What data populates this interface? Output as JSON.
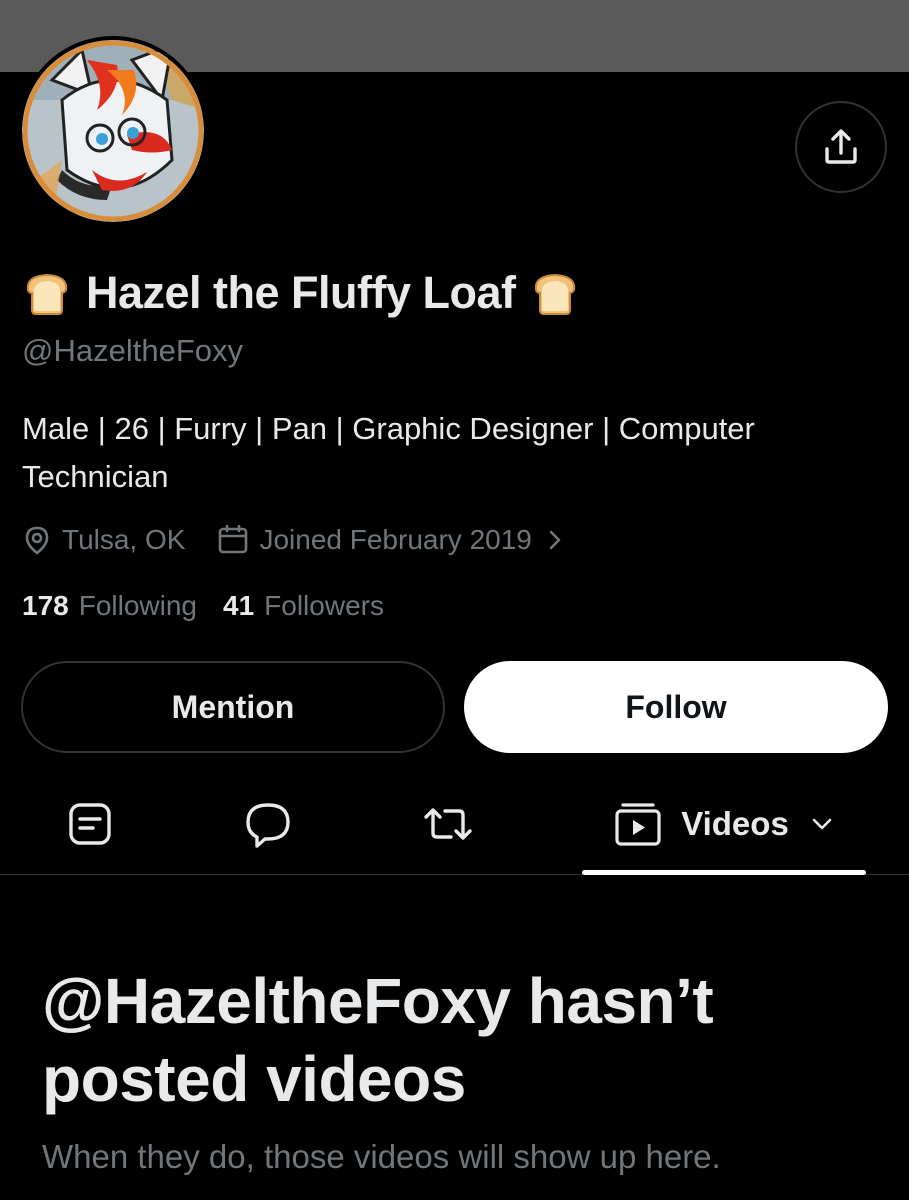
{
  "profile": {
    "display_name": "Hazel the Fluffy Loaf",
    "name_emoji_left": "bread-emoji",
    "name_emoji_right": "bread-emoji",
    "handle": "@HazeltheFoxy",
    "bio": "Male | 26 | Furry | Pan | Graphic Designer | Computer Technician",
    "location": "Tulsa, OK",
    "joined": "Joined February 2019",
    "following_count": "178",
    "following_label": "Following",
    "followers_count": "41",
    "followers_label": "Followers"
  },
  "actions": {
    "mention_label": "Mention",
    "follow_label": "Follow",
    "share_icon": "share-icon"
  },
  "tabs": [
    {
      "icon": "posts-icon"
    },
    {
      "icon": "replies-icon"
    },
    {
      "icon": "reposts-icon"
    },
    {
      "icon": "videos-icon",
      "label": "Videos",
      "selected": true
    }
  ],
  "empty_state": {
    "title": "@HazeltheFoxy hasn’t posted videos",
    "subtitle": "When they do, those videos will show up here."
  },
  "colors": {
    "background": "#000000",
    "banner": "#5a5a5a",
    "primary_text": "#e7e9ea",
    "secondary_text": "#71767b",
    "border": "#2f3336",
    "follow_button_bg": "#ffffff"
  }
}
